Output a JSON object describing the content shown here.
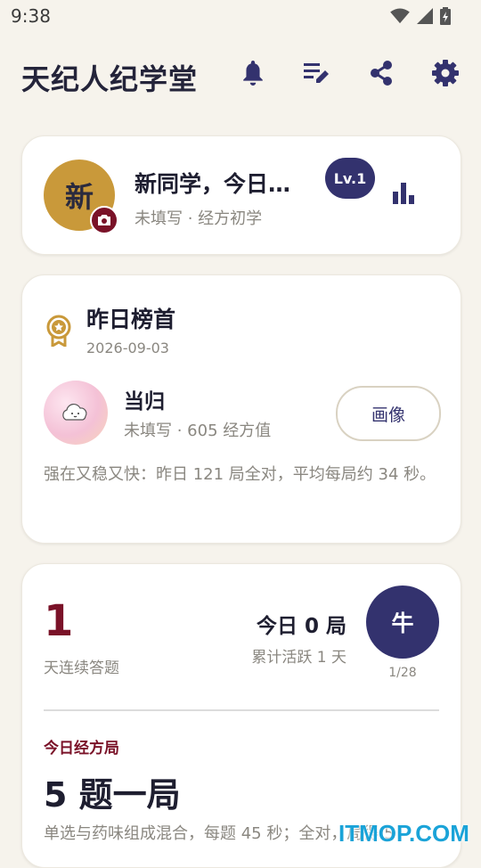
{
  "status": {
    "time": "9:38"
  },
  "header": {
    "title": "天纪人纪学堂"
  },
  "profile": {
    "avatar_char": "新",
    "name": "新同学，今日…",
    "subtitle": "未填写 · 经方初学",
    "level": "Lv.1"
  },
  "top_card": {
    "title": "昨日榜首",
    "date": "2026-09-03",
    "name": "当归",
    "subtitle": "未填写 · 605 经方值",
    "portrait_button": "画像",
    "description": "强在又稳又快：昨日 121 局全对，平均每局约 34 秒。"
  },
  "streak": {
    "days": "1",
    "days_label": "天连续答题",
    "today": "今日 0 局",
    "active": "累计活跃 1 天",
    "zodiac": "牛",
    "progress": "1/28",
    "game_label": "今日经方局",
    "game_title": "5 题一局",
    "game_desc": "单选与药味组成混合，每题 45 秒；全对，局得 5"
  },
  "watermark": "ITMOP.COM",
  "colors": {
    "accent": "#33326e",
    "maroon": "#7a1228",
    "gold": "#c9993a",
    "background": "#f6f3ec"
  },
  "icons": [
    "wifi-icon",
    "signal-icon",
    "battery-icon",
    "bell-icon",
    "edit-list-icon",
    "share-icon",
    "settings-icon",
    "camera-icon",
    "bar-chart-icon",
    "medal-icon"
  ]
}
